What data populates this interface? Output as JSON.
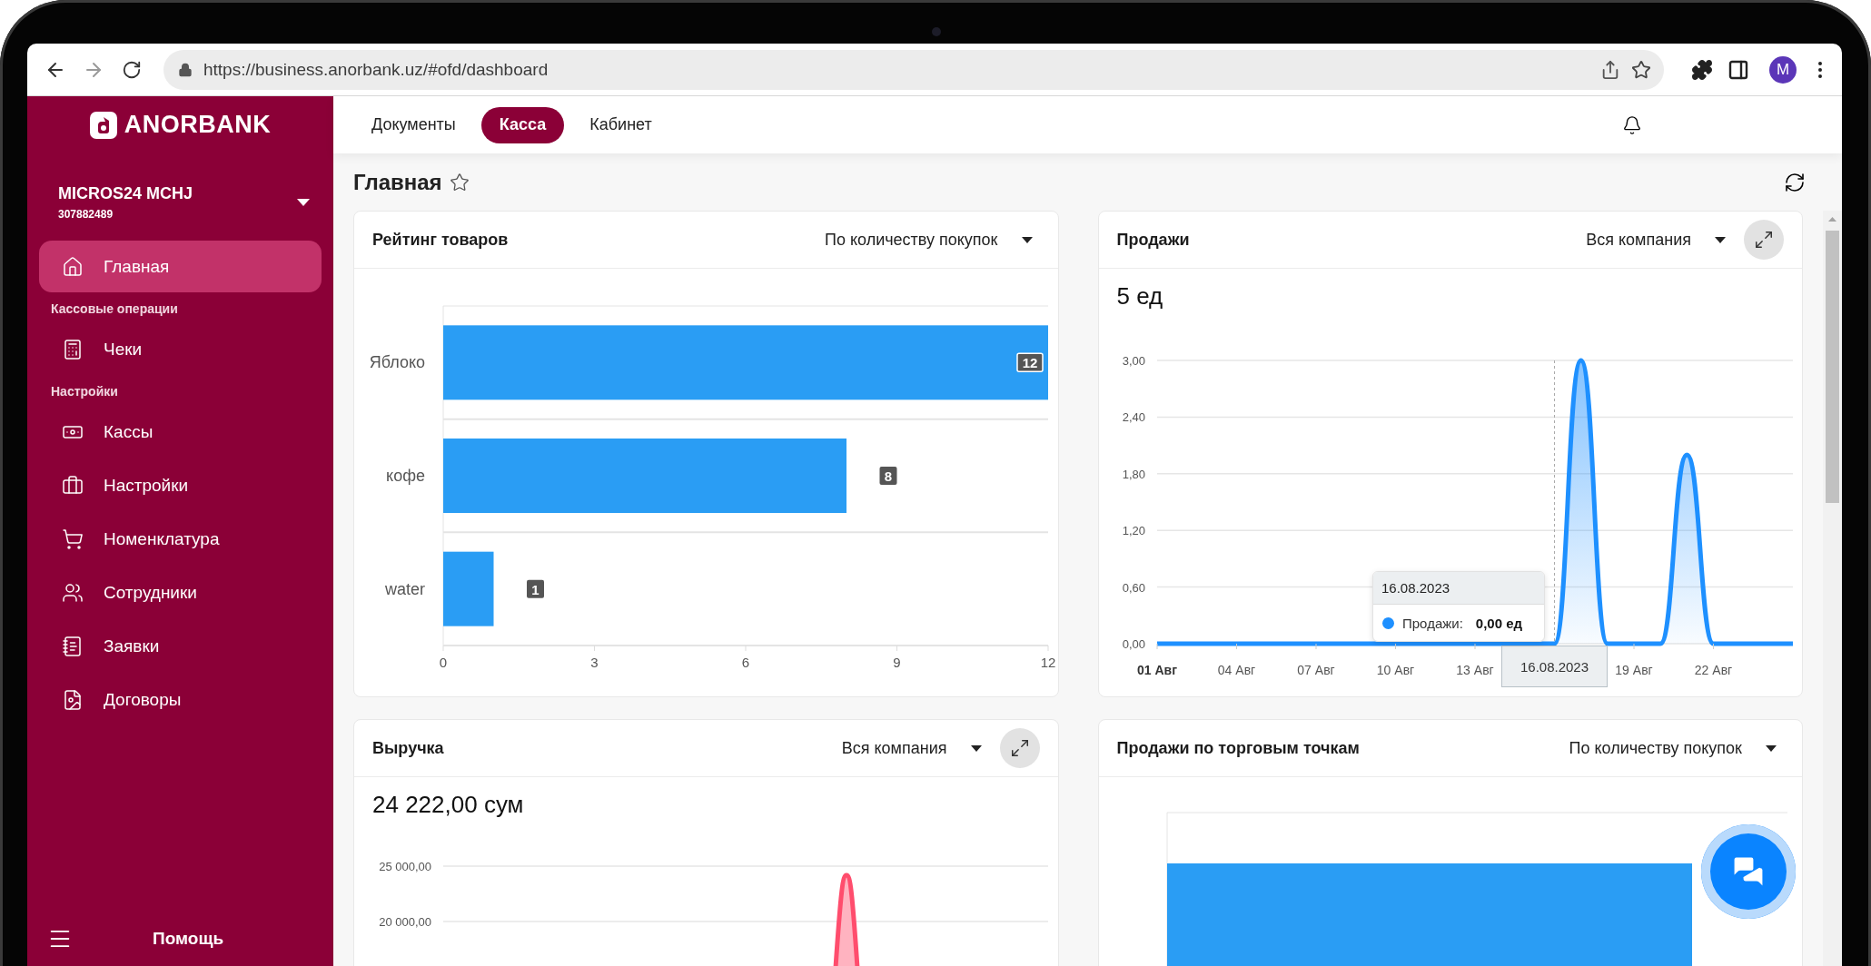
{
  "browser": {
    "url": "https://business.anorbank.uz/#ofd/dashboard",
    "profile": "M"
  },
  "sidebar": {
    "logo": "ANORBANK",
    "company": {
      "name": "MICROS24 MCHJ",
      "inn": "307882489"
    },
    "menu": [
      {
        "kind": "item",
        "label": "Главная",
        "selected": true
      },
      {
        "kind": "heading",
        "label": "Кассовые операции"
      },
      {
        "kind": "item",
        "label": "Чеки",
        "selected": false
      },
      {
        "kind": "heading",
        "label": "Настройки"
      },
      {
        "kind": "item",
        "label": "Кассы",
        "selected": false
      },
      {
        "kind": "item",
        "label": "Настройки",
        "selected": false
      },
      {
        "kind": "item",
        "label": "Номенклатура",
        "selected": false
      },
      {
        "kind": "item",
        "label": "Сотрудники",
        "selected": false
      },
      {
        "kind": "item",
        "label": "Заявки",
        "selected": false
      },
      {
        "kind": "item",
        "label": "Договоры",
        "selected": false
      }
    ],
    "help": "Помощь"
  },
  "tabs": [
    {
      "label": "Документы",
      "selected": false
    },
    {
      "label": "Касса",
      "selected": true
    },
    {
      "label": "Кабинет",
      "selected": false
    }
  ],
  "page_title": "Главная",
  "cards": [
    {
      "kind": "chart",
      "title": "Рейтинг товаров",
      "filter": "По количеству покупок",
      "expandable": false,
      "chart_data": {
        "type": "bar",
        "orientation": "horizontal",
        "categories": [
          "Яблоко",
          "кофе",
          "water"
        ],
        "values": [
          12,
          8,
          1
        ],
        "xlim": [
          0,
          12
        ],
        "xticks": [
          0,
          3,
          6,
          9,
          12
        ],
        "data_labels": true
      }
    },
    {
      "kind": "chart",
      "title": "Продажи",
      "filter": "Вся компания",
      "expandable": true,
      "total": "5 ед",
      "chart_data": {
        "type": "area",
        "grid": true,
        "x": [
          1,
          2,
          3,
          4,
          5,
          6,
          7,
          8,
          9,
          10,
          11,
          12,
          13,
          14,
          15,
          16,
          17,
          18,
          19,
          20,
          21,
          22,
          23,
          24,
          25
        ],
        "series": [
          {
            "color": "#1e90ff",
            "values": [
              0,
              0,
              0,
              0,
              0,
              0,
              0,
              0,
              0,
              0,
              0,
              0,
              0,
              0,
              0,
              0,
              3,
              0,
              0,
              0,
              2,
              0,
              0,
              0,
              0
            ]
          }
        ],
        "xlim": [
          1,
          25
        ],
        "ylim": [
          0,
          3
        ],
        "xticks": [
          {
            "value": 1,
            "label": "01 Авг"
          },
          {
            "value": 4,
            "label": "04 Авг"
          },
          {
            "value": 7,
            "label": "07 Авг"
          },
          {
            "value": 10,
            "label": "10 Авг"
          },
          {
            "value": 13,
            "label": "13 Авг"
          },
          {
            "value": 19,
            "label": "19 Авг"
          },
          {
            "value": 22,
            "label": "22 Авг"
          }
        ],
        "yticks": [
          {
            "value": 0,
            "label": "0,00"
          },
          {
            "value": 0.6,
            "label": "0,60"
          },
          {
            "value": 1.2,
            "label": "1,20"
          },
          {
            "value": 1.8,
            "label": "1,80"
          },
          {
            "value": 2.4,
            "label": "2,40"
          },
          {
            "value": 3,
            "label": "3,00"
          }
        ],
        "ref_lines": [
          {
            "axis": "x",
            "value": 16,
            "label": "16.08.2023"
          }
        ]
      },
      "tooltip": {
        "title": "16.08.2023",
        "label": "Продажи:",
        "value": "0,00 ед"
      }
    },
    {
      "kind": "line-picture",
      "title": "Выручка",
      "filter": "Вся компания",
      "expandable": true,
      "total": "24 222,00 сум",
      "y_labels": [
        "25 000,00",
        "20 000,00"
      ]
    },
    {
      "kind": "bar-picture",
      "title": "Продажи по торговым точкам",
      "filter": "По количеству покупок",
      "expandable": false
    }
  ]
}
